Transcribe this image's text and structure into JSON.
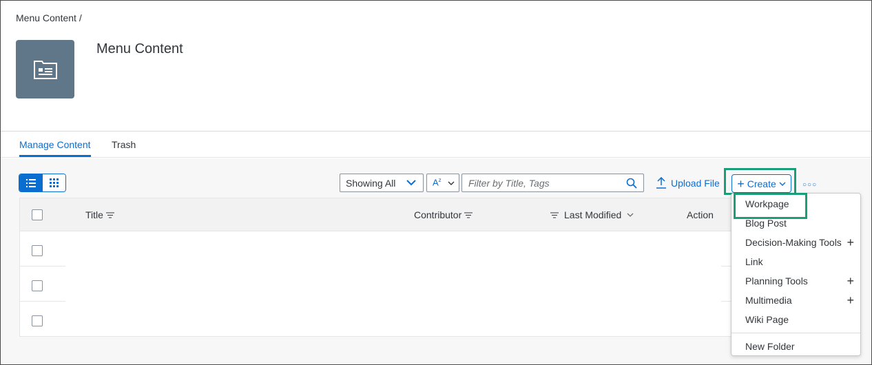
{
  "breadcrumb": "Menu Content /",
  "page": {
    "title": "Menu Content"
  },
  "tabs": [
    {
      "label": "Manage Content",
      "active": true
    },
    {
      "label": "Trash",
      "active": false
    }
  ],
  "toolbar": {
    "showing_select": "Showing All",
    "filter_placeholder": "Filter by Title, Tags",
    "upload_label": "Upload File",
    "create_label": "Create"
  },
  "table": {
    "columns": [
      "Title",
      "Contributor",
      "Last Modified",
      "Action"
    ]
  },
  "create_menu": {
    "items": [
      {
        "label": "Workpage",
        "submenu": false
      },
      {
        "label": "Blog Post",
        "submenu": false
      },
      {
        "label": "Decision-Making Tools",
        "submenu": true
      },
      {
        "label": "Link",
        "submenu": false
      },
      {
        "label": "Planning Tools",
        "submenu": true
      },
      {
        "label": "Multimedia",
        "submenu": true
      },
      {
        "label": "Wiki Page",
        "submenu": false
      }
    ],
    "footer_item": "New Folder"
  },
  "colors": {
    "accent": "#0a6ed1",
    "highlight": "#1a9e7a",
    "avatar_bg": "#5f7788"
  },
  "icons": [
    "content-folder-icon",
    "list-view-icon",
    "grid-view-icon",
    "sort-icon",
    "search-icon",
    "upload-icon",
    "plus-icon",
    "chevron-down-icon",
    "more-icon"
  ]
}
